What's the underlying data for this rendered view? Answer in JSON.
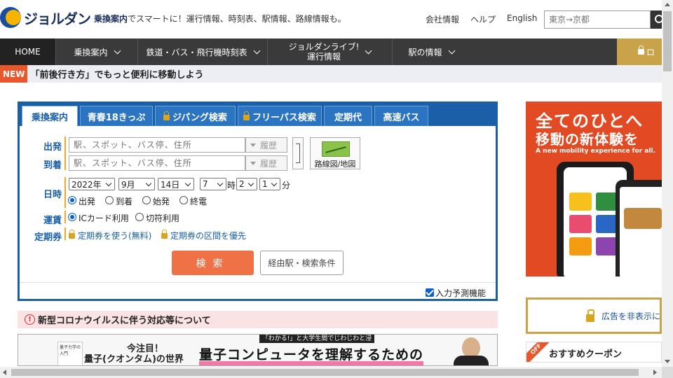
{
  "header": {
    "logo_text": "ジョルダン",
    "tagline_bold": "乗換案内",
    "tagline_rest": "でスマートに！運行情報、時刻表、駅情報、路線情報も。",
    "links": [
      "会社情報",
      "ヘルプ",
      "English"
    ],
    "search_placeholder": "東京→京都"
  },
  "nav": {
    "home": "HOME",
    "items": [
      "乗換案内",
      "鉄道・バス・飛行機時刻表",
      "ジョルダンライブ!",
      "運行情報",
      "駅の情報"
    ],
    "login": "ロ"
  },
  "news": {
    "badge": "NEW",
    "text": "「前後行き方」でもっと便利に移動しよう"
  },
  "panel": {
    "tabs": [
      "乗換案内",
      "青春18きっぷ",
      "ジパング検索",
      "フリーパス検索",
      "定期代",
      "高速バス"
    ],
    "labels": {
      "from": "出発",
      "to": "到着",
      "datetime": "日時",
      "fare": "運賃",
      "pass": "定期券"
    },
    "station_placeholder": "駅、スポット、バス停、住所",
    "history_label": "履歴",
    "map_label": "路線図/地図",
    "year": "2022年",
    "month": "9月",
    "day": "14日",
    "hour": "7",
    "hour_unit": "時",
    "minute_tens": "2",
    "minute_ones": "1",
    "minute_unit": "分",
    "time_modes": [
      "出発",
      "到着",
      "始発",
      "終電"
    ],
    "fare_modes": [
      "ICカード利用",
      "切符利用"
    ],
    "pass_options": [
      "定期券を使う(無料)",
      "定期券の区間を優先"
    ],
    "search_label": "検索",
    "conditions_label": "経由駅・検索条件",
    "predict_label": "入力予測機能"
  },
  "notice": {
    "icon_text": "!",
    "text": "新型コロナウイルスに伴う対応等について"
  },
  "banner": {
    "book_text": "量子力学の入門",
    "top_text": "今注目！",
    "sub_text": "量子(クオンタム)の世界",
    "badge_text": "「わかる!」と大学生間でじわじわと浸透中",
    "main_text": "量子コンピュータを理解するための"
  },
  "ad": {
    "title1": "全てのひとへ",
    "title2": "移動の新体験を",
    "subtitle": "A new mobility experience for all."
  },
  "remove_ads": {
    "text": "広告を非表示に"
  },
  "coupon": {
    "ribbon": "OFF",
    "title": "おすすめクーポン"
  }
}
